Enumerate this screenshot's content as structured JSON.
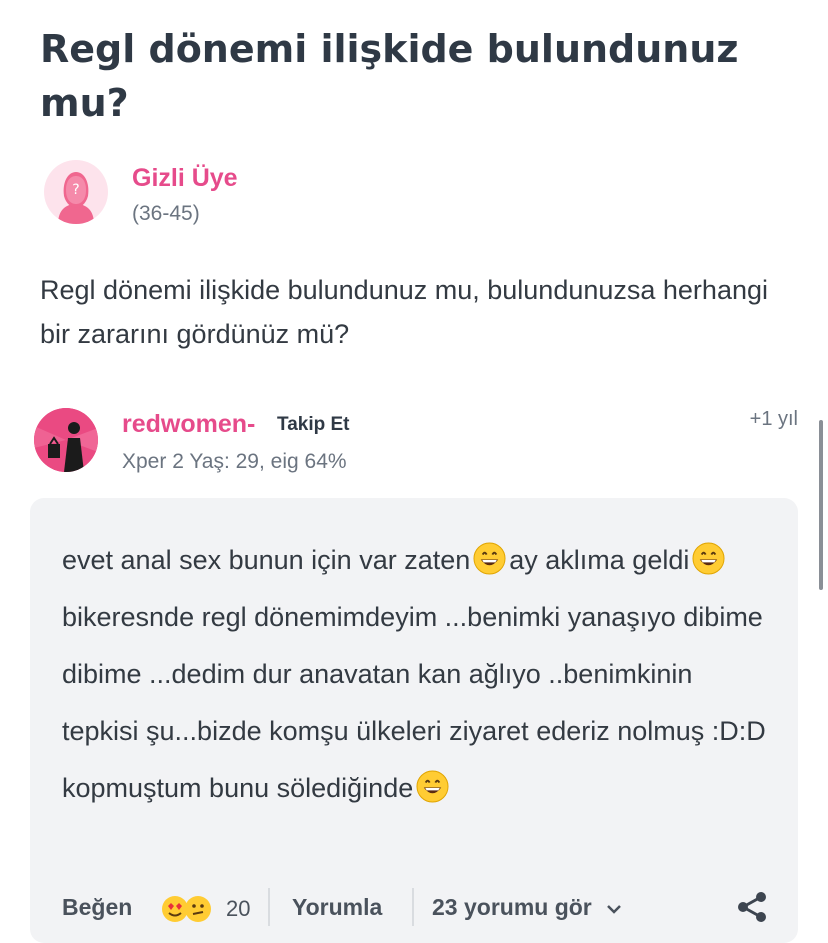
{
  "question": {
    "title": "Regl dönemi ilişkide bulundunuz mu?",
    "body": "Regl dönemi ilişkide bulundunuz mu, bulundunuzsa herhangi bir zararını gördünüz mü?"
  },
  "asker": {
    "name": "Gizli Üye",
    "age": "(36-45)",
    "avatar_icon": "anonymous-female-avatar-icon"
  },
  "answer": {
    "author": "redwomen-",
    "follow_label": "Takip Et",
    "meta": "Xper 2 Yaş: 29, eig 64%",
    "time": "+1 yıl",
    "text_parts": {
      "p1": "evet anal sex bunun için var zaten",
      "p2": "ay aklıma geldi",
      "p3": "bikeresnde regl dönemimdeyim ...benimki yanaşıyo dibime dibime ...dedim dur anavatan kan ağlıyo ..benimkinin tepkisi şu...bizde komşu ülkeleri ziyaret ederiz nolmuş :D:D kopmuştum bunu sölediğinde"
    }
  },
  "actions": {
    "like_label": "Beğen",
    "reaction_count": "20",
    "comment_label": "Yorumla",
    "view_comments_label": "23 yorumu gör"
  },
  "colors": {
    "accent": "#e64b8b",
    "text": "#333a42",
    "muted": "#6b7480",
    "answer_bg": "#f2f3f5"
  }
}
